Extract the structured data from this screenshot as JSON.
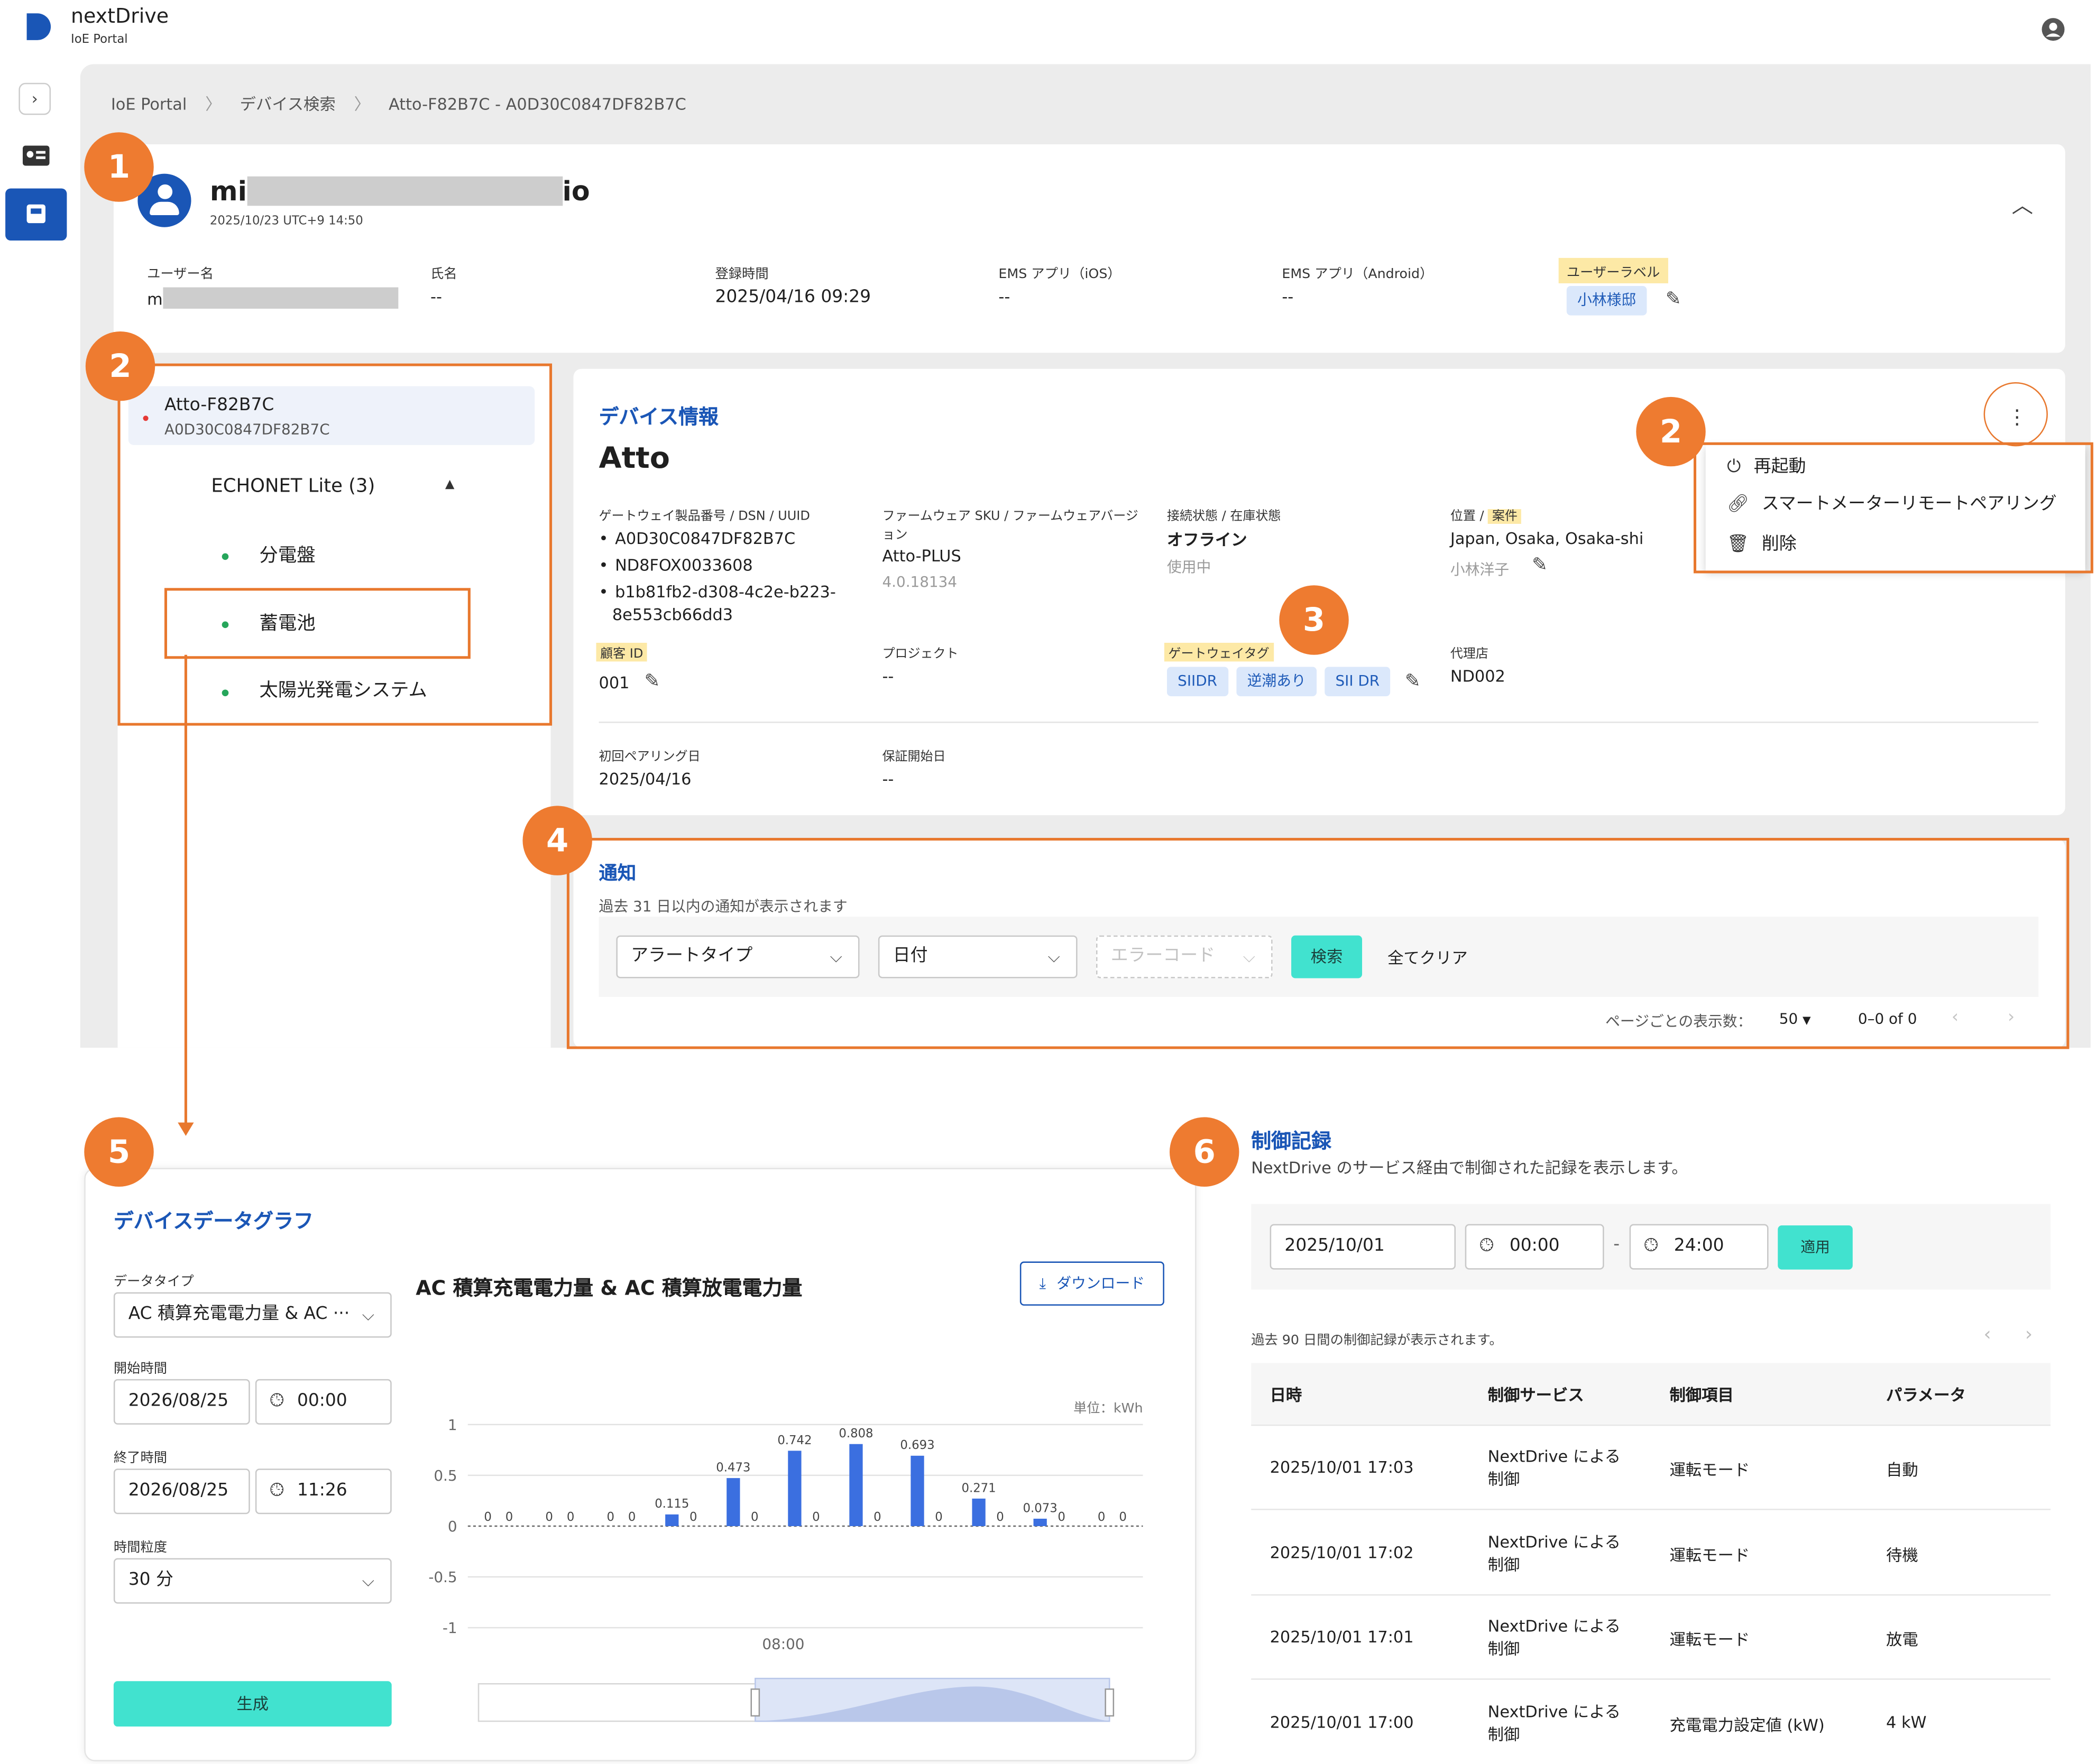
{
  "app": {
    "brand": "nextDrive",
    "subtitle": "IoE Portal"
  },
  "breadcrumb": [
    "IoE Portal",
    "デバイス検索",
    "Atto-F82B7C - A0D30C0847DF82B7C"
  ],
  "user": {
    "name_start": "mi",
    "name_end": "io",
    "timestamp": "2025/10/23 UTC+9 14:50",
    "fields": {
      "username_label": "ユーザー名",
      "username_value": "m",
      "fullname_label": "氏名",
      "fullname_value": "--",
      "registered_label": "登録時間",
      "registered_value": "2025/04/16 09:29",
      "ems_ios_label": "EMS アプリ（iOS）",
      "ems_ios_value": "--",
      "ems_android_label": "EMS アプリ（Android）",
      "ems_android_value": "--",
      "user_label_label": "ユーザーラベル",
      "user_label_chip": "小林様邸"
    }
  },
  "device_tree": {
    "device_name": "Atto-F82B7C",
    "device_id": "A0D30C0847DF82B7C",
    "group": "ECHONET Lite (3)",
    "children": [
      "分電盤",
      "蓄電池",
      "太陽光発電システム"
    ]
  },
  "device_info": {
    "section_title": "デバイス情報",
    "name": "Atto",
    "gw_label": "ゲートウェイ製品番号 / DSN / UUID",
    "gw_values": [
      "A0D30C0847DF82B7C",
      "ND8FOX0033608",
      "b1b81fb2-d308-4c2e-b223-",
      "8e553cb66dd3"
    ],
    "fw_label_1": "ファームウェア SKU / ファームウェアバージ",
    "fw_label_2": "ョン",
    "fw_sku": "Atto-PLUS",
    "fw_version": "4.0.18134",
    "conn_label": "接続状態 / 在庫状態",
    "conn_value": "オフライン",
    "stock_value": "使用中",
    "loc_label_a": "位置 / ",
    "loc_label_b": "案件",
    "loc_value": "Japan, Osaka, Osaka-shi",
    "case_value": "小林洋子",
    "customer_id_label": "顧客 ID",
    "customer_id_value": "001",
    "project_label": "プロジェクト",
    "project_value": "--",
    "gw_tag_label": "ゲートウェイタグ",
    "gw_tags": [
      "SIIDR",
      "逆潮あり",
      "SII DR"
    ],
    "agency_label": "代理店",
    "agency_value": "ND002",
    "pairing_label": "初回ペアリング日",
    "pairing_value": "2025/04/16",
    "warranty_label": "保証開始日",
    "warranty_value": "--"
  },
  "menu": {
    "items": [
      "再起動",
      "スマートメーターリモートペアリング",
      "削除"
    ]
  },
  "notifications": {
    "title": "通知",
    "subtitle": "過去 31 日以内の通知が表示されます",
    "alert_type": "アラートタイプ",
    "date": "日付",
    "error_code": "エラーコード",
    "search": "検索",
    "clear_all": "全てクリア",
    "per_page_label": "ページごとの表示数：",
    "per_page": "50",
    "range": "0–0 of 0"
  },
  "graph": {
    "title": "デバイスデータグラフ",
    "data_type_label": "データタイプ",
    "data_type_value": "AC 積算充電電力量 & AC ···",
    "start_label": "開始時間",
    "start_date": "2026/08/25",
    "start_time": "00:00",
    "end_label": "終了時間",
    "end_date": "2026/08/25",
    "end_time": "11:26",
    "granularity_label": "時間粒度",
    "granularity_value": "30 分",
    "generate": "生成",
    "chart_title": "AC 積算充電電力量 & AC 積算放電電力量",
    "download": "ダウンロード",
    "unit": "単位：kWh",
    "x_label": "08:00"
  },
  "chart_data": {
    "type": "bar",
    "title": "AC 積算充電電力量 & AC 積算放電電力量",
    "ylabel": "単位：kWh",
    "ylim": [
      -1,
      1
    ],
    "yticks": [
      "1",
      "0.5",
      "0",
      "-0.5",
      "-1"
    ],
    "x_ticks": [
      "08:00"
    ],
    "grid": true,
    "series": [
      {
        "values": [
          0,
          0,
          0,
          0.115,
          0.473,
          0.742,
          0.808,
          0.693,
          0.271,
          0.073,
          0
        ]
      },
      {
        "values": [
          0,
          0,
          0,
          0,
          0,
          0,
          0,
          0,
          0,
          0,
          0
        ]
      }
    ],
    "color": "#3b6fe0"
  },
  "control_log": {
    "title": "制御記録",
    "subtitle": "NextDrive のサービス経由で制御された記録を表示します。",
    "date": "2025/10/01",
    "from": "00:00",
    "dash": "-",
    "to": "24:00",
    "apply": "適用",
    "range_note": "過去 90 日間の制御記録が表示されます。",
    "headers": [
      "日時",
      "制御サービス",
      "制御項目",
      "パラメータ"
    ],
    "rows": [
      {
        "time": "2025/10/01 17:03",
        "service_1": "NextDrive による",
        "service_2": "制御",
        "item": "運転モード",
        "param": "自動"
      },
      {
        "time": "2025/10/01 17:02",
        "service_1": "NextDrive による",
        "service_2": "制御",
        "item": "運転モード",
        "param": "待機"
      },
      {
        "time": "2025/10/01 17:01",
        "service_1": "NextDrive による",
        "service_2": "制御",
        "item": "運転モード",
        "param": "放電"
      },
      {
        "time": "2025/10/01 17:00",
        "service_1": "NextDrive による",
        "service_2": "制御",
        "item": "充電電力設定値 (kW)",
        "param": "4 kW"
      }
    ]
  },
  "badges": [
    "1",
    "2",
    "2",
    "3",
    "4",
    "5",
    "6"
  ],
  "icons": [
    "logo-icon",
    "account-icon",
    "chevron-right-icon",
    "id-card-icon",
    "device-icon",
    "user-avatar-icon",
    "chevron-up-icon",
    "more-vert-icon",
    "power-icon",
    "link-icon",
    "trash-icon",
    "pencil-icon",
    "download-icon",
    "clock-icon"
  ]
}
